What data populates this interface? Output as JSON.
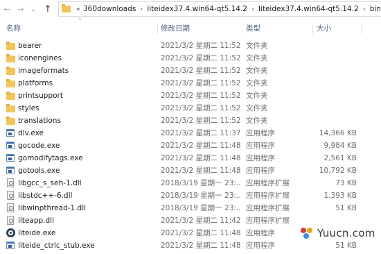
{
  "address": {
    "crumbs": [
      "360downloads",
      "liteidex37.4.win64-qt5.14.2",
      "liteidex37.4.win64-qt5.14.2",
      "bin"
    ]
  },
  "columns": {
    "name": "名称",
    "date": "修改日期",
    "type": "类型",
    "size": "大小"
  },
  "files": [
    {
      "name": "bearer",
      "date": "2021/3/2 星期二 11:52",
      "type": "文件夹",
      "size": "",
      "icon": "folder-icon"
    },
    {
      "name": "iconengines",
      "date": "2021/3/2 星期二 11:52",
      "type": "文件夹",
      "size": "",
      "icon": "folder-icon"
    },
    {
      "name": "imageformats",
      "date": "2021/3/2 星期二 11:52",
      "type": "文件夹",
      "size": "",
      "icon": "folder-icon"
    },
    {
      "name": "platforms",
      "date": "2021/3/2 星期二 11:52",
      "type": "文件夹",
      "size": "",
      "icon": "folder-icon"
    },
    {
      "name": "printsupport",
      "date": "2021/3/2 星期二 11:52",
      "type": "文件夹",
      "size": "",
      "icon": "folder-icon"
    },
    {
      "name": "styles",
      "date": "2021/3/2 星期二 11:52",
      "type": "文件夹",
      "size": "",
      "icon": "folder-icon"
    },
    {
      "name": "translations",
      "date": "2021/3/2 星期二 11:52",
      "type": "文件夹",
      "size": "",
      "icon": "folder-icon"
    },
    {
      "name": "dlv.exe",
      "date": "2021/3/2 星期二 11:37",
      "type": "应用程序",
      "size": "14,366 KB",
      "icon": "exe-icon"
    },
    {
      "name": "gocode.exe",
      "date": "2021/3/2 星期二 11:48",
      "type": "应用程序",
      "size": "9,984 KB",
      "icon": "exe-icon"
    },
    {
      "name": "gomodifytags.exe",
      "date": "2021/3/2 星期二 11:48",
      "type": "应用程序",
      "size": "2,561 KB",
      "icon": "exe-icon"
    },
    {
      "name": "gotools.exe",
      "date": "2021/3/2 星期二 11:48",
      "type": "应用程序",
      "size": "10,792 KB",
      "icon": "exe-icon"
    },
    {
      "name": "libgcc_s_seh-1.dll",
      "date": "2018/3/19 星期一 23:...",
      "type": "应用程序扩展",
      "size": "73 KB",
      "icon": "dll-icon"
    },
    {
      "name": "libstdc++-6.dll",
      "date": "2018/3/19 星期一 23:...",
      "type": "应用程序扩展",
      "size": "1,393 KB",
      "icon": "dll-icon"
    },
    {
      "name": "libwinpthread-1.dll",
      "date": "2018/3/19 星期一 23:...",
      "type": "应用程序扩展",
      "size": "51 KB",
      "icon": "dll-icon"
    },
    {
      "name": "liteapp.dll",
      "date": "2021/3/2 星期二 11:42",
      "type": "应用程序扩展",
      "size": "",
      "icon": "dll-icon"
    },
    {
      "name": "liteide.exe",
      "date": "2021/3/2 星期二 11:48",
      "type": "应用程序",
      "size": "",
      "icon": "liteide-icon"
    },
    {
      "name": "liteide_ctrlc_stub.exe",
      "date": "2021/3/2 星期二 11:48",
      "type": "应用程序",
      "size": "51 KB",
      "icon": "exe-icon"
    }
  ],
  "watermark": {
    "text": "Yuucn.com"
  }
}
